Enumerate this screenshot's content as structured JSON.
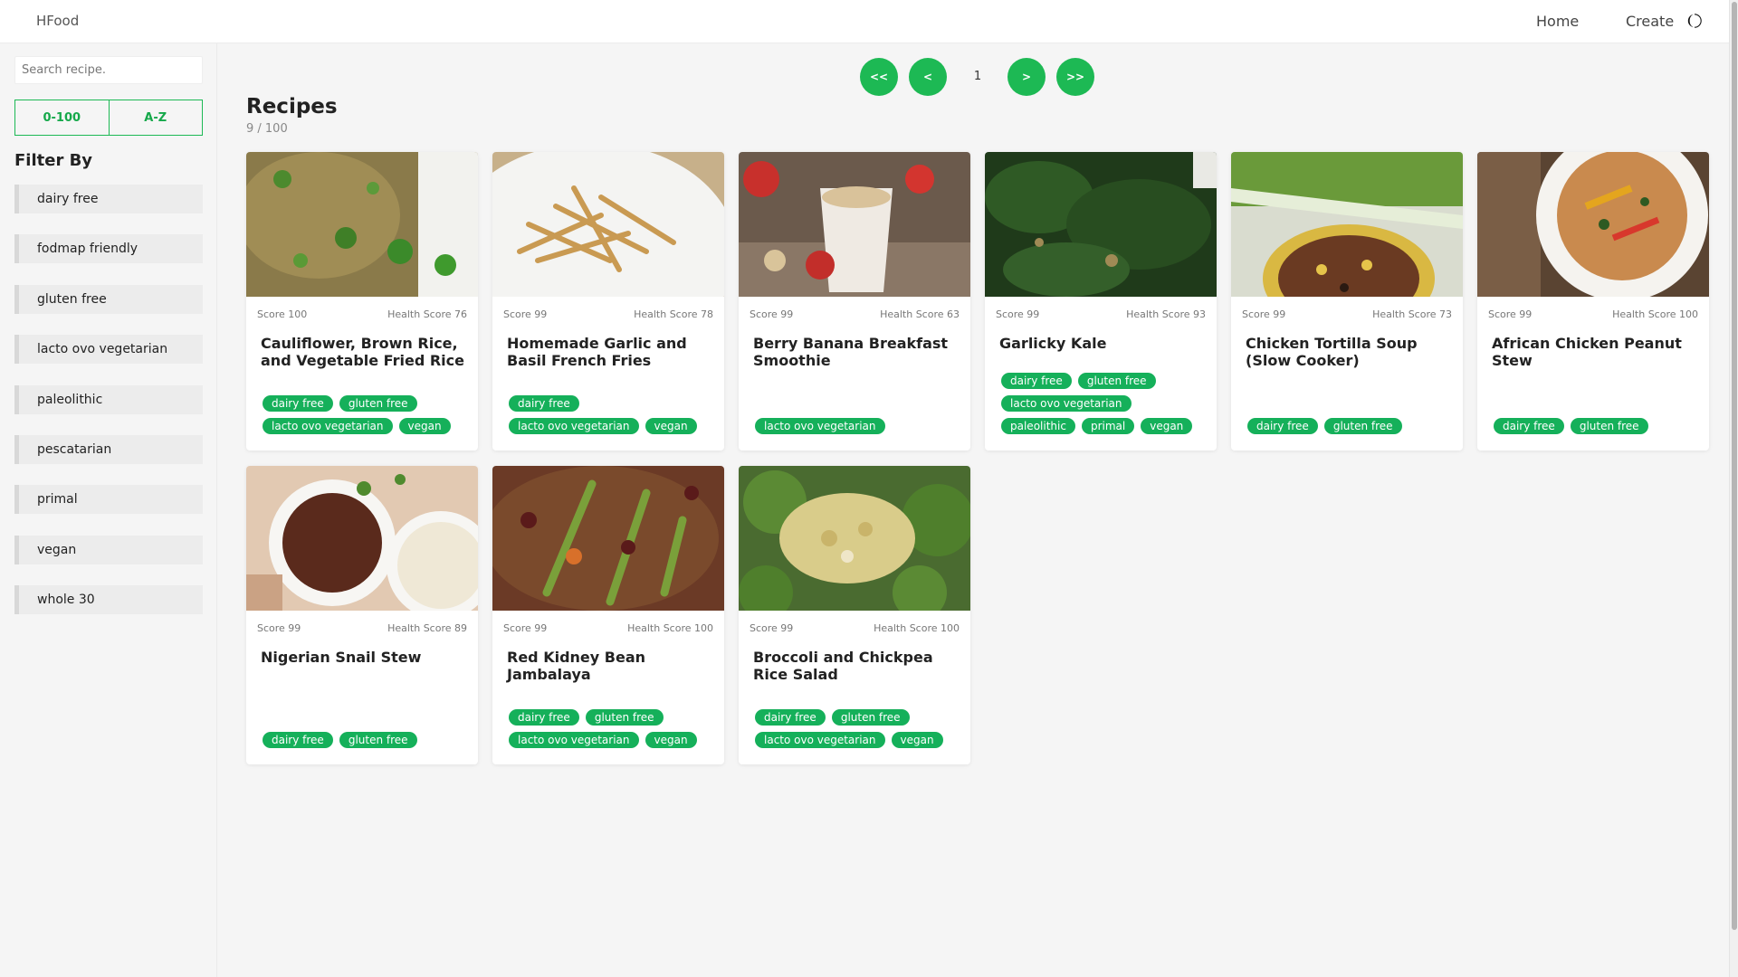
{
  "nav": {
    "brand": "HFood",
    "home": "Home",
    "create": "Create"
  },
  "sidebar": {
    "search_placeholder": "Search recipe.",
    "sort": [
      "0-100",
      "A-Z"
    ],
    "filter_title": "Filter By",
    "filters": [
      "dairy free",
      "fodmap friendly",
      "gluten free",
      "lacto ovo vegetarian",
      "paleolithic",
      "pescatarian",
      "primal",
      "vegan",
      "whole 30"
    ]
  },
  "pagination": {
    "first": "<<",
    "prev": "<",
    "current": "1",
    "next": ">",
    "last": ">>"
  },
  "main": {
    "heading": "Recipes",
    "count": "9 / 100"
  },
  "recipes": [
    {
      "score": "Score 100",
      "health": "Health Score 76",
      "title": "Cauliflower, Brown Rice, and Vegetable Fried Rice",
      "tags": [
        "dairy free",
        "gluten free",
        "lacto ovo vegetarian",
        "vegan"
      ],
      "image": "fried-rice-photo"
    },
    {
      "score": "Score 99",
      "health": "Health Score 78",
      "title": "Homemade Garlic and Basil French Fries",
      "tags": [
        "dairy free",
        "lacto ovo vegetarian",
        "vegan"
      ],
      "image": "french-fries-photo"
    },
    {
      "score": "Score 99",
      "health": "Health Score 63",
      "title": "Berry Banana Breakfast Smoothie",
      "tags": [
        "lacto ovo vegetarian"
      ],
      "image": "smoothie-photo"
    },
    {
      "score": "Score 99",
      "health": "Health Score 93",
      "title": "Garlicky Kale",
      "tags": [
        "dairy free",
        "gluten free",
        "lacto ovo vegetarian",
        "paleolithic",
        "primal",
        "vegan"
      ],
      "image": "kale-photo"
    },
    {
      "score": "Score 99",
      "health": "Health Score 73",
      "title": "Chicken Tortilla Soup (Slow Cooker)",
      "tags": [
        "dairy free",
        "gluten free"
      ],
      "image": "tortilla-soup-photo"
    },
    {
      "score": "Score 99",
      "health": "Health Score 100",
      "title": "African Chicken Peanut Stew",
      "tags": [
        "dairy free",
        "gluten free"
      ],
      "image": "peanut-stew-photo"
    },
    {
      "score": "Score 99",
      "health": "Health Score 89",
      "title": "Nigerian Snail Stew",
      "tags": [
        "dairy free",
        "gluten free"
      ],
      "image": "snail-stew-photo"
    },
    {
      "score": "Score 99",
      "health": "Health Score 100",
      "title": "Red Kidney Bean Jambalaya",
      "tags": [
        "dairy free",
        "gluten free",
        "lacto ovo vegetarian",
        "vegan"
      ],
      "image": "jambalaya-photo"
    },
    {
      "score": "Score 99",
      "health": "Health Score 100",
      "title": "Broccoli and Chickpea Rice Salad",
      "tags": [
        "dairy free",
        "gluten free",
        "lacto ovo vegetarian",
        "vegan"
      ],
      "image": "broccoli-salad-photo"
    }
  ],
  "colors": {
    "accent": "#1db954",
    "tag": "#15b05a",
    "background": "#f5f5f5"
  }
}
